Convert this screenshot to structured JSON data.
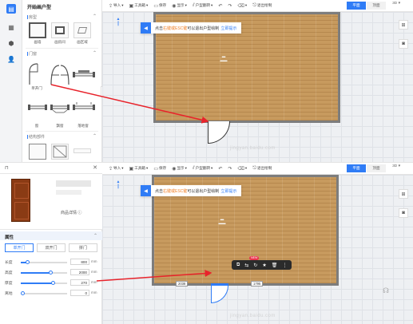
{
  "top_pane": {
    "panel_title": "开始画户型",
    "section_room": "房型",
    "room_tiles": [
      "画墙",
      "画房间",
      "画区域"
    ],
    "section_doors": "门窗",
    "door_tiles": [
      "单开门",
      "双开门",
      "推拉门",
      "窗",
      "飘窗",
      "落地窗"
    ],
    "section_struct": "结构部件",
    "wm_text": "jingyan.baidu.com"
  },
  "toolbar": {
    "items": [
      {
        "icon": "import-icon",
        "label": "导入"
      },
      {
        "icon": "toolbox-icon",
        "label": "工具箱"
      },
      {
        "icon": "save-icon",
        "label": "保存"
      },
      {
        "icon": "display-icon",
        "label": "显示"
      },
      {
        "icon": "draw-icon",
        "label": "户型翻转"
      },
      {
        "icon": "undo-icon",
        "label": ""
      },
      {
        "icon": "redo-icon",
        "label": ""
      },
      {
        "icon": "clear-icon",
        "label": ""
      },
      {
        "icon": "exit-icon",
        "label": "退出绘制"
      }
    ],
    "view_2d": "平面",
    "view_top": "顶面",
    "view_3d": "3D"
  },
  "tip": {
    "text_a": "点击",
    "text_hl": "右键或ESC键",
    "text_b": "可以退出户型绘制",
    "link": "立即提示"
  },
  "bottom_pane": {
    "product_detail": "商品详情",
    "props_title": "属性",
    "door_types": [
      "单开门",
      "双开门",
      "拼门"
    ],
    "props": [
      {
        "label": "长度",
        "value": "800",
        "unit": "mm",
        "fraction": 0.15
      },
      {
        "label": "高度",
        "value": "2000",
        "unit": "mm",
        "fraction": 0.65
      },
      {
        "label": "厚度",
        "value": "270",
        "unit": "mm",
        "fraction": 0.7
      },
      {
        "label": "离地",
        "value": "0",
        "unit": "mm",
        "fraction": 0.0
      }
    ],
    "dim_left": "2038",
    "dim_right": "1795",
    "new_badge": "NEW"
  }
}
